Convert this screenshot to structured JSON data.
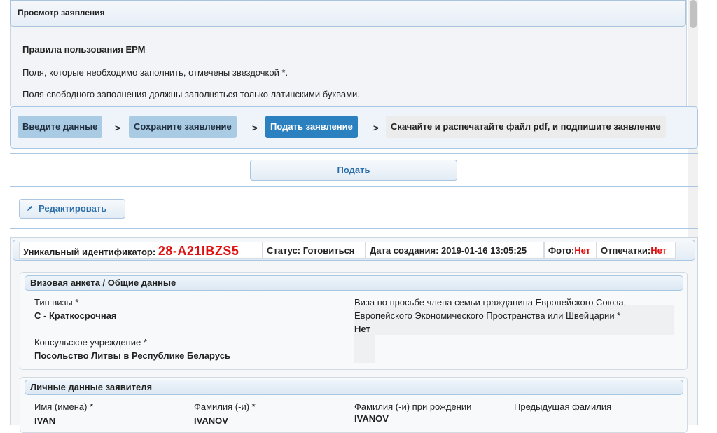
{
  "header": {
    "title": "Просмотр заявления"
  },
  "rules": {
    "title": "Правила пользования ЕРМ",
    "line1": "Поля, которые необходимо заполнить, отмечены звездочкой *.",
    "line2": "Поля свободного заполнения должны заполняться только латинскими буквами."
  },
  "steps": [
    {
      "label": "Введите данные",
      "state": "done"
    },
    {
      "label": "Сохраните заявление",
      "state": "done"
    },
    {
      "label": "Подать заявление",
      "state": "active"
    },
    {
      "label": "Скачайте и распечатайте файл pdf, и подпишите заявление",
      "state": "todo"
    }
  ],
  "arrow": ">",
  "buttons": {
    "submit": "Подать",
    "edit": "Редактировать",
    "edit_icon": "pencil-icon"
  },
  "id_bar": {
    "id_label": "Уникальный идентификатор:",
    "id_value": "28-A21IBZS5",
    "status": "Статус: Готовиться",
    "created": "Дата создания: 2019-01-16 13:05:25",
    "photo_label": "Фото:",
    "photo_value": "Нет",
    "prints_label": "Отпечатки:",
    "prints_value": "Нет"
  },
  "visa_section": {
    "title": "Визовая анкета / Общие данные",
    "visa_type_label": "Тип визы *",
    "visa_type_value": "C - Краткосрочная",
    "consulate_label": "Консульское учреждение *",
    "consulate_value": "Посольство Литвы в Республике Беларусь",
    "family_label_1": "Виза по просьбе члена семьи гражданина Европейского Союза,",
    "family_label_2": "Европейского Экономического Пространства или Швейцарии *",
    "family_value": "Нет"
  },
  "personal_section": {
    "title": "Личные данные заявителя",
    "name_label": "Имя (имена) *",
    "name_value": "IVAN",
    "surname_label": "Фамилия (-и) *",
    "surname_value": "IVANOV",
    "birth_surname_label": "Фамилия (-и) при рождении",
    "birth_surname_value": "IVANOV",
    "prev_surname_label": "Предыдущая фамилия"
  },
  "colors": {
    "accent": "#2b80c0",
    "red": "#e01010",
    "border": "#a9c6e3"
  }
}
